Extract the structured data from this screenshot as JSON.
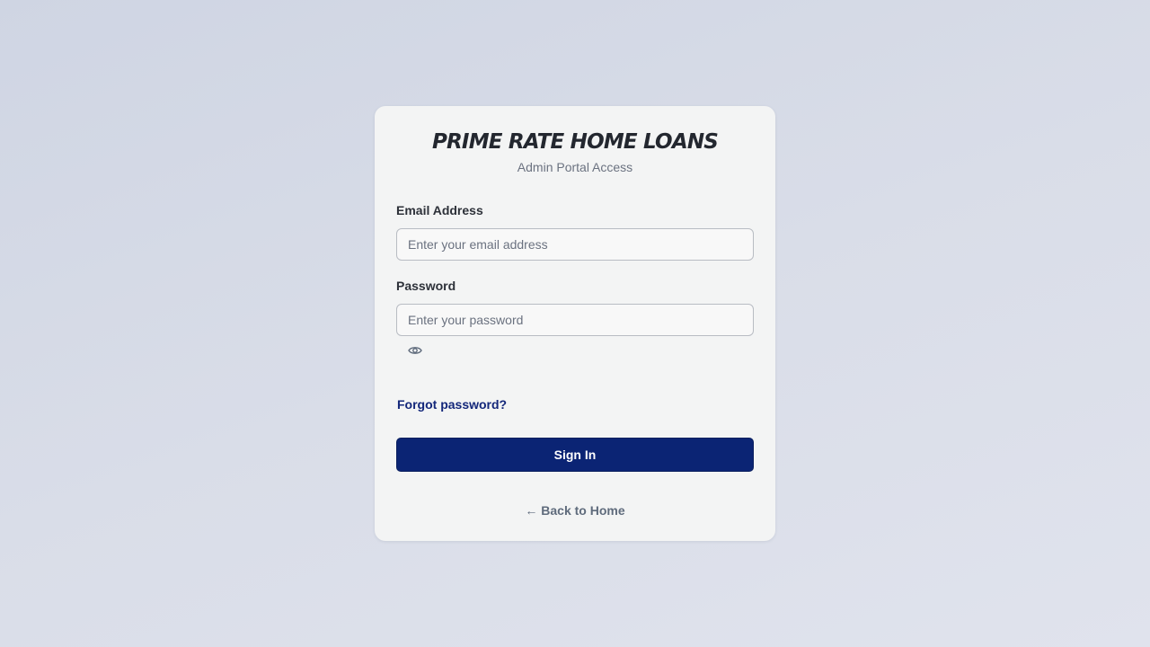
{
  "brand": {
    "title": "PRIME RATE HOME LOANS",
    "subtitle": "Admin Portal Access"
  },
  "form": {
    "email_label": "Email Address",
    "email_placeholder": "Enter your email address",
    "email_value": "",
    "password_label": "Password",
    "password_placeholder": "Enter your password",
    "password_value": "",
    "toggle_icon": "eye-icon",
    "forgot_label": "Forgot password?",
    "submit_label": "Sign In"
  },
  "footer": {
    "back_label": "← Back to Home"
  },
  "colors": {
    "primary": "#0b2474",
    "link": "#13277a",
    "muted": "#6b7280",
    "card_bg": "#f3f4f4"
  }
}
